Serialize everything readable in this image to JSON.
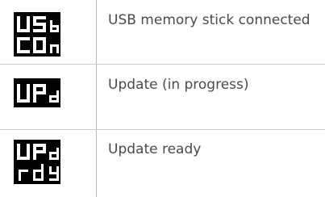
{
  "rows": [
    {
      "display": {
        "line1": "USb",
        "line2": "COn"
      },
      "description": "USB memory stick connected"
    },
    {
      "display": {
        "line1": "UPd"
      },
      "description": "Update (in progress)"
    },
    {
      "display": {
        "line1": "UPd",
        "line2": "rdY"
      },
      "description": "Update ready"
    }
  ],
  "colors": {
    "display_bg": "#000000",
    "segment_on": "#ffffff",
    "text": "#4a4a4a",
    "rule": "#c9c9c9"
  }
}
